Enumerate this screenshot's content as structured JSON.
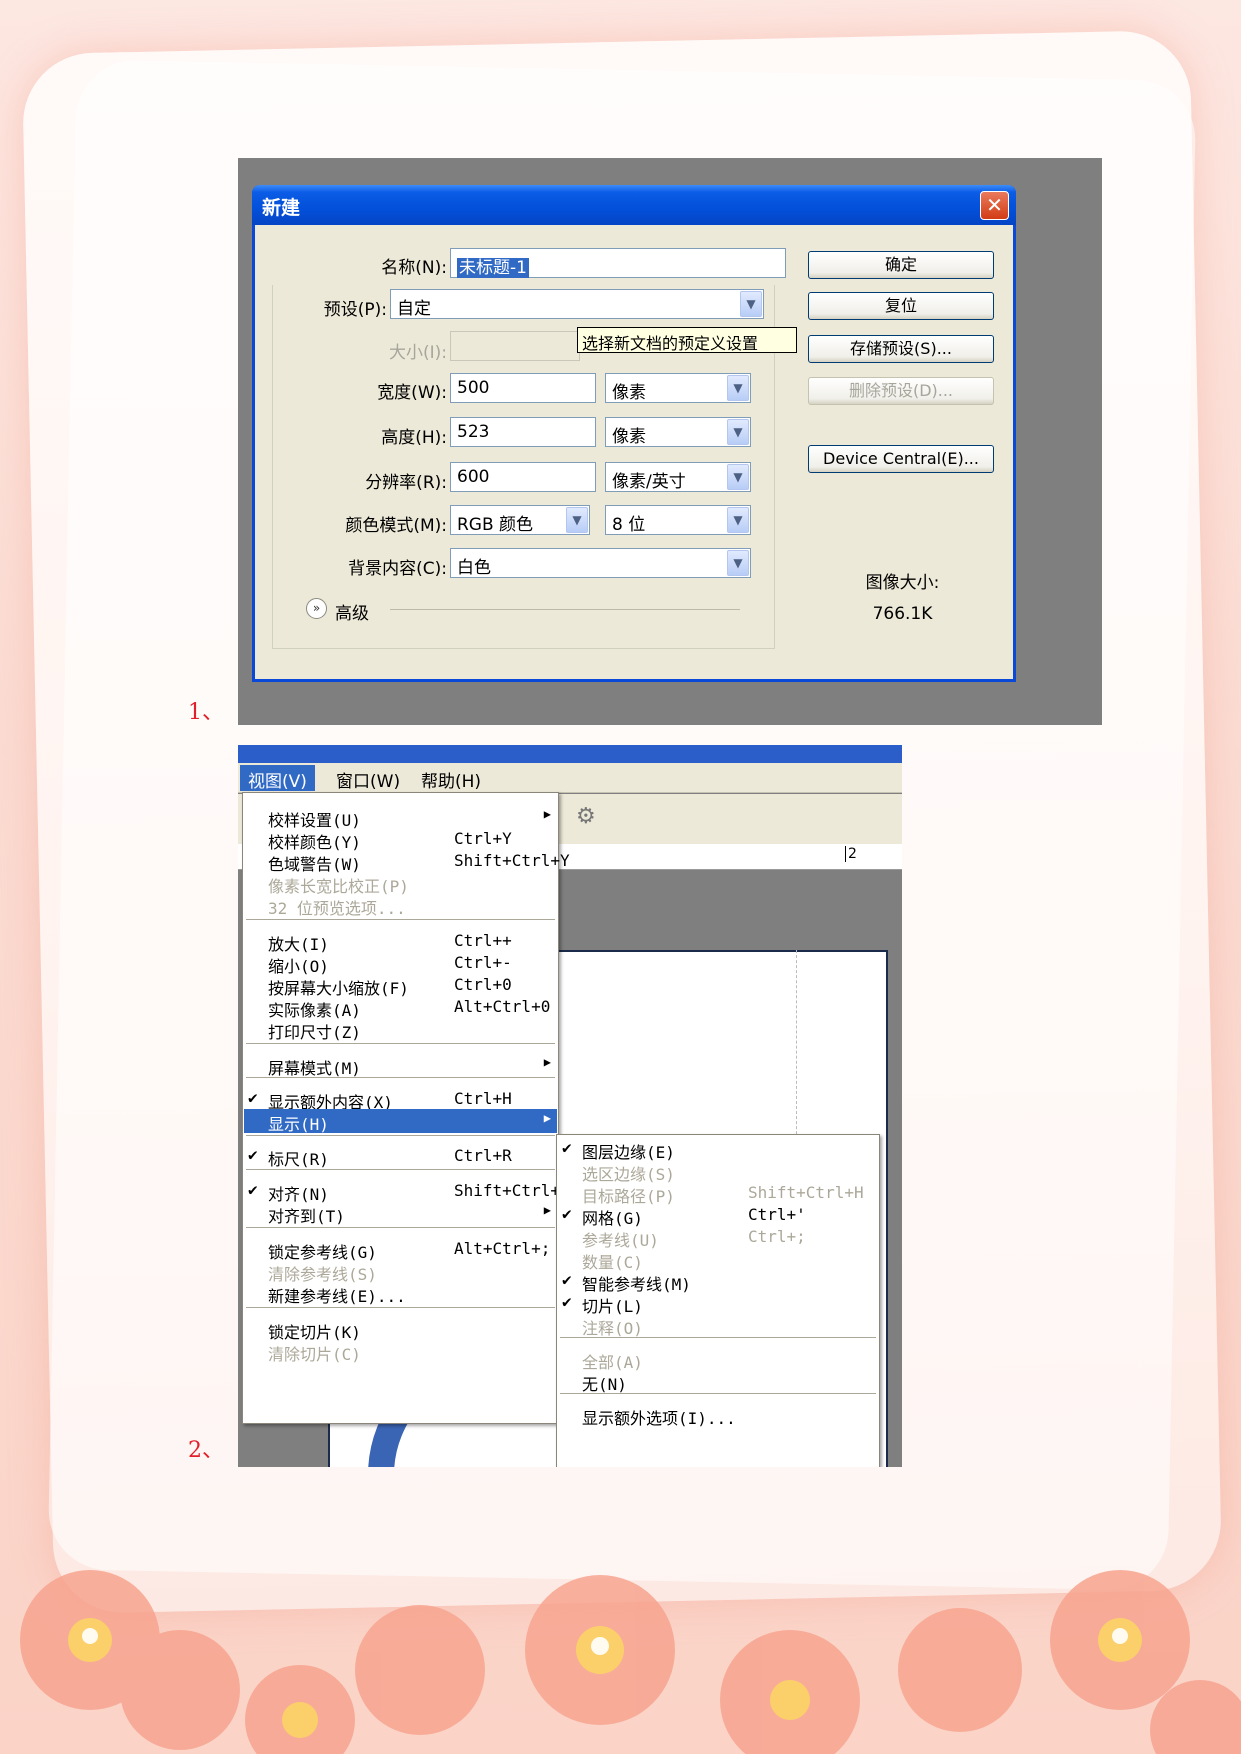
{
  "labels": {
    "one": "1、",
    "two": "2、"
  },
  "dialog": {
    "title": "新建",
    "name_label": "名称(N):",
    "name_value": "未标题-1",
    "preset_label": "预设(P):",
    "preset_value": "自定",
    "size_label": "大小(I):",
    "tooltip": "选择新文档的预定义设置",
    "width_label": "宽度(W):",
    "width_value": "500",
    "width_unit": "像素",
    "height_label": "高度(H):",
    "height_value": "523",
    "height_unit": "像素",
    "res_label": "分辨率(R):",
    "res_value": "600",
    "res_unit": "像素/英寸",
    "color_label": "颜色模式(M):",
    "color_value": "RGB 颜色",
    "bit_value": "8 位",
    "bg_label": "背景内容(C):",
    "bg_value": "白色",
    "advanced": "高级",
    "buttons": {
      "ok": "确定",
      "reset": "复位",
      "save_preset": "存储预设(S)...",
      "delete_preset": "删除预设(D)...",
      "device_central": "Device Central(E)..."
    },
    "image_size_label": "图像大小:",
    "image_size_value": "766.1K"
  },
  "menubar": {
    "view": "视图(V)",
    "window": "窗口(W)",
    "help": "帮助(H)"
  },
  "ruler_mark": "2",
  "view_menu": {
    "items": [
      {
        "label": "校样设置(U)",
        "shortcut": "",
        "submenu": true
      },
      {
        "label": "校样颜色(Y)",
        "shortcut": "Ctrl+Y"
      },
      {
        "label": "色域警告(W)",
        "shortcut": "Shift+Ctrl+Y"
      },
      {
        "label": "像素长宽比校正(P)",
        "shortcut": "",
        "disabled": true
      },
      {
        "label": "32 位预览选项...",
        "shortcut": "",
        "disabled": true
      },
      {
        "label": "放大(I)",
        "shortcut": "Ctrl++"
      },
      {
        "label": "缩小(O)",
        "shortcut": "Ctrl+-"
      },
      {
        "label": "按屏幕大小缩放(F)",
        "shortcut": "Ctrl+0"
      },
      {
        "label": "实际像素(A)",
        "shortcut": "Alt+Ctrl+0"
      },
      {
        "label": "打印尺寸(Z)",
        "shortcut": ""
      },
      {
        "label": "屏幕模式(M)",
        "shortcut": "",
        "submenu": true
      },
      {
        "label": "显示额外内容(X)",
        "shortcut": "Ctrl+H",
        "checked": true
      },
      {
        "label": "显示(H)",
        "shortcut": "",
        "submenu": true,
        "highlighted": true
      },
      {
        "label": "标尺(R)",
        "shortcut": "Ctrl+R",
        "checked": true
      },
      {
        "label": "对齐(N)",
        "shortcut": "Shift+Ctrl+;",
        "checked": true
      },
      {
        "label": "对齐到(T)",
        "shortcut": "",
        "submenu": true
      },
      {
        "label": "锁定参考线(G)",
        "shortcut": "Alt+Ctrl+;"
      },
      {
        "label": "清除参考线(S)",
        "shortcut": "",
        "disabled": true
      },
      {
        "label": "新建参考线(E)...",
        "shortcut": ""
      },
      {
        "label": "锁定切片(K)",
        "shortcut": ""
      },
      {
        "label": "清除切片(C)",
        "shortcut": "",
        "disabled": true
      }
    ]
  },
  "show_submenu": {
    "items": [
      {
        "label": "图层边缘(E)",
        "shortcut": "",
        "checked": true
      },
      {
        "label": "选区边缘(S)",
        "shortcut": "",
        "disabled": true
      },
      {
        "label": "目标路径(P)",
        "shortcut": "Shift+Ctrl+H",
        "disabled": true
      },
      {
        "label": "网格(G)",
        "shortcut": "Ctrl+'",
        "checked": true
      },
      {
        "label": "参考线(U)",
        "shortcut": "Ctrl+;",
        "disabled": true
      },
      {
        "label": "数量(C)",
        "shortcut": "",
        "disabled": true
      },
      {
        "label": "智能参考线(M)",
        "shortcut": "",
        "checked": true
      },
      {
        "label": "切片(L)",
        "shortcut": "",
        "checked": true
      },
      {
        "label": "注释(O)",
        "shortcut": "",
        "disabled": true
      },
      {
        "label": "全部(A)",
        "shortcut": "",
        "disabled": true
      },
      {
        "label": "无(N)",
        "shortcut": ""
      },
      {
        "label": "显示额外选项(I)...",
        "shortcut": ""
      }
    ]
  },
  "colors": {
    "accent": "#316ac5",
    "title_bar": "#0350da",
    "label_red": "#e0202a"
  }
}
